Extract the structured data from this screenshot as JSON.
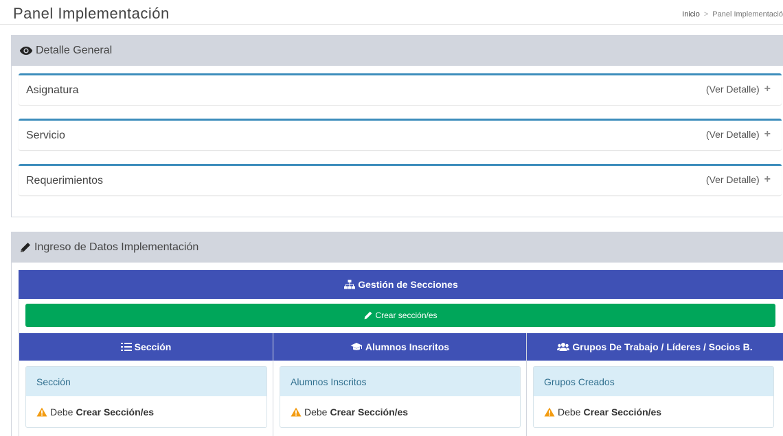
{
  "header": {
    "title": "Panel Implementación",
    "breadcrumb": {
      "home": "Inicio",
      "separator": ">",
      "current": "Panel Implementació"
    }
  },
  "detalle_general": {
    "title": "Detalle General",
    "icon": "eye-icon",
    "panels": [
      {
        "label": "Asignatura",
        "detail_label": "(Ver Detalle)"
      },
      {
        "label": "Servicio",
        "detail_label": "(Ver Detalle)"
      },
      {
        "label": "Requerimientos",
        "detail_label": "(Ver Detalle)"
      }
    ]
  },
  "ingreso": {
    "title": "Ingreso de Datos Implementación",
    "icon": "pencil-icon",
    "gestion": {
      "title": "Gestión de Secciones",
      "icon": "sitemap-icon",
      "create_button": "Crear sección/es"
    },
    "columns": [
      {
        "header": "Sección",
        "icon": "list-icon",
        "card_title": "Sección",
        "warning_text": "Debe",
        "warning_strong": "Crear Sección/es"
      },
      {
        "header": "Alumnos Inscritos",
        "icon": "graduation-cap-icon",
        "card_title": "Alumnos Inscritos",
        "warning_text": "Debe",
        "warning_strong": "Crear Sección/es"
      },
      {
        "header": "Grupos De Trabajo / Líderes / Socios B.",
        "icon": "users-icon",
        "card_title": "Grupos Creados",
        "warning_text": "Debe",
        "warning_strong": "Crear Sección/es"
      }
    ]
  },
  "colors": {
    "header_gray": "#d2d6de",
    "panel_blue_border": "#3c8dbc",
    "indigo": "#3f51b5",
    "green": "#00a65a",
    "info_bg": "#d9edf7",
    "info_text": "#31708f",
    "warning": "#f39c12"
  }
}
